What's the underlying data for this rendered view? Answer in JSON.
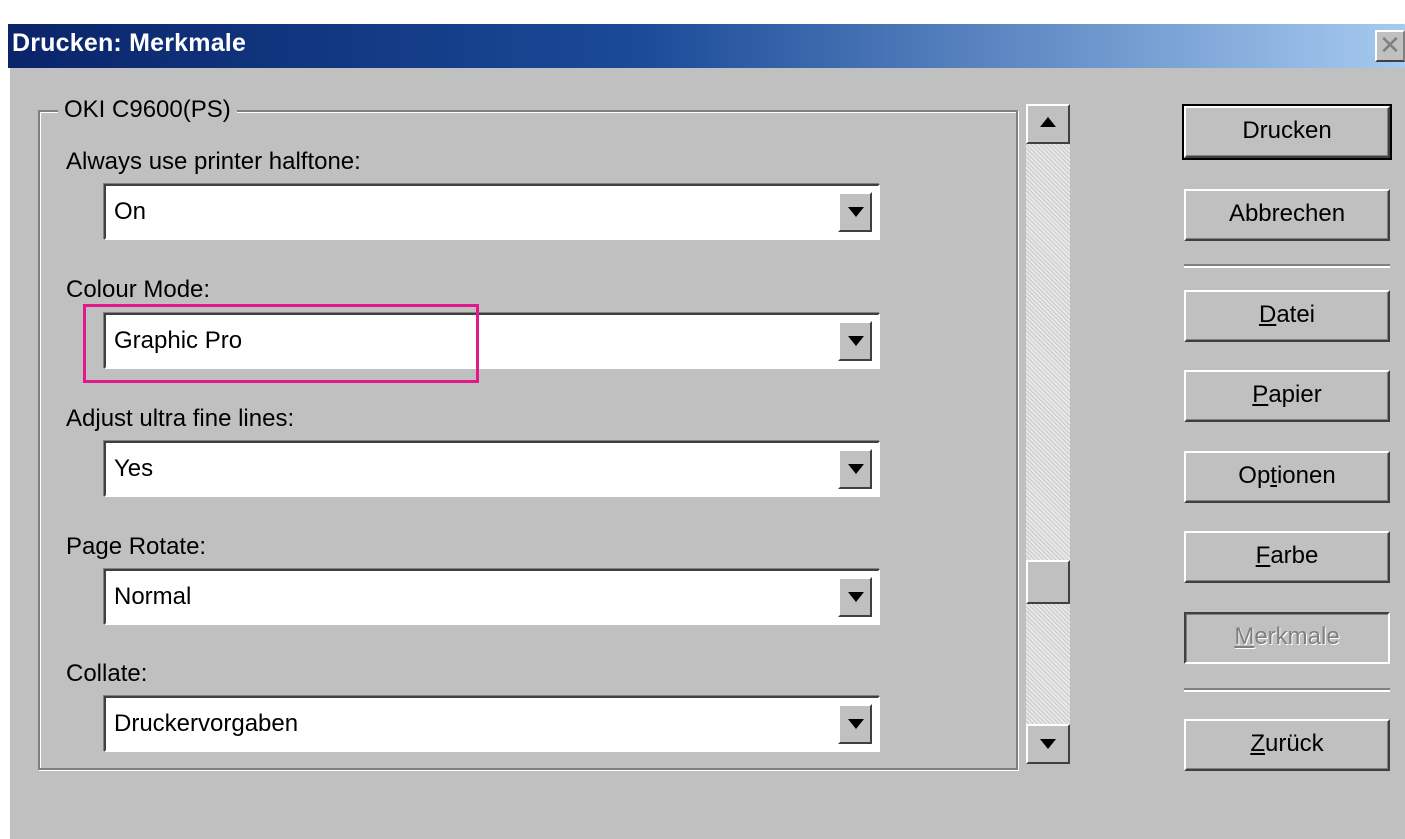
{
  "window": {
    "title": "Drucken: Merkmale",
    "close_glyph": "✕"
  },
  "group": {
    "legend": "OKI C9600(PS)"
  },
  "fields": [
    {
      "label": "Always use printer halftone:",
      "value": "On"
    },
    {
      "label": "Colour Mode:",
      "value": "Graphic Pro"
    },
    {
      "label": "Adjust ultra fine lines:",
      "value": "Yes"
    },
    {
      "label": "Page Rotate:",
      "value": "Normal"
    },
    {
      "label": "Collate:",
      "value": "Druckervorgaben"
    }
  ],
  "buttons": {
    "print": "Drucken",
    "cancel": "Abbrechen",
    "file": {
      "mnemonic": "D",
      "rest": "atei"
    },
    "paper": {
      "mnemonic": "P",
      "rest": "apier"
    },
    "options": {
      "pre": "Op",
      "mnemonic": "t",
      "rest": "ionen"
    },
    "color": {
      "mnemonic": "F",
      "rest": "arbe"
    },
    "features": {
      "mnemonic": "M",
      "rest": "erkmale"
    },
    "back": {
      "mnemonic": "Z",
      "rest": "urück"
    }
  },
  "highlight_color": "#e0198c"
}
